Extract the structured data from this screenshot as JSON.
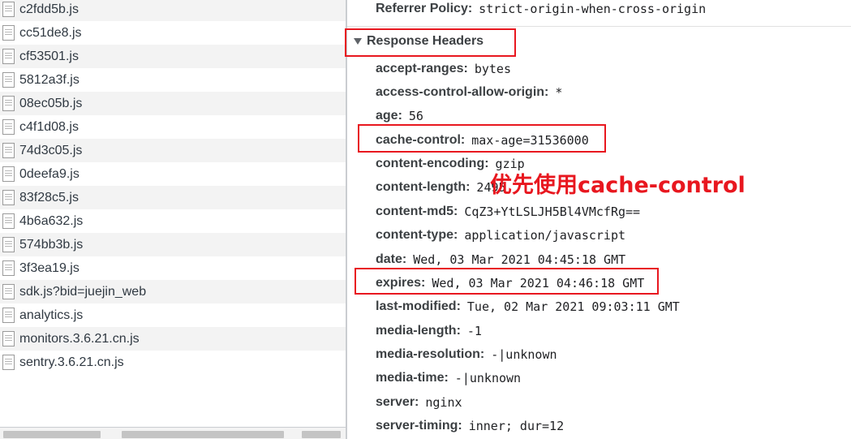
{
  "files": [
    "c2fdd5b.js",
    "cc51de8.js",
    "cf53501.js",
    "5812a3f.js",
    "08ec05b.js",
    "c4f1d08.js",
    "74d3c05.js",
    "0deefa9.js",
    "83f28c5.js",
    "4b6a632.js",
    "574bb3b.js",
    "3f3ea19.js",
    "sdk.js?bid=juejin_web",
    "analytics.js",
    "monitors.3.6.21.cn.js",
    "sentry.3.6.21.cn.js"
  ],
  "general": {
    "referrer_policy": {
      "name": "Referrer Policy",
      "value": "strict-origin-when-cross-origin"
    }
  },
  "response_headers": {
    "title": "Response Headers",
    "items": [
      {
        "name": "accept-ranges",
        "value": "bytes"
      },
      {
        "name": "access-control-allow-origin",
        "value": "*"
      },
      {
        "name": "age",
        "value": "56"
      },
      {
        "name": "cache-control",
        "value": "max-age=31536000"
      },
      {
        "name": "content-encoding",
        "value": "gzip"
      },
      {
        "name": "content-length",
        "value": "2495"
      },
      {
        "name": "content-md5",
        "value": "CqZ3+YtLSLJH5Bl4VMcfRg=="
      },
      {
        "name": "content-type",
        "value": "application/javascript"
      },
      {
        "name": "date",
        "value": "Wed, 03 Mar 2021 04:45:18 GMT"
      },
      {
        "name": "expires",
        "value": "Wed, 03 Mar 2021 04:46:18 GMT"
      },
      {
        "name": "last-modified",
        "value": "Tue, 02 Mar 2021 09:03:11 GMT"
      },
      {
        "name": "media-length",
        "value": "-1"
      },
      {
        "name": "media-resolution",
        "value": "-|unknown"
      },
      {
        "name": "media-time",
        "value": "-|unknown"
      },
      {
        "name": "server",
        "value": "nginx"
      },
      {
        "name": "server-timing",
        "value": "inner; dur=12"
      }
    ]
  },
  "annotation": "优先使用cache-control",
  "colors": {
    "highlight": "#e8171f",
    "row_alt": "#f3f3f3"
  },
  "icons": {
    "file": "file-icon",
    "toggle": "triangle-down-icon"
  }
}
